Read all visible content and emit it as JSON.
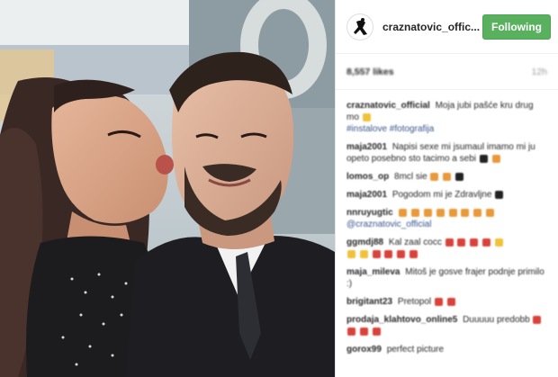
{
  "post": {
    "username": "craznatovic_offic...",
    "follow_label": "Following",
    "likes": "8,557 likes",
    "time": "12h"
  },
  "comments": [
    {
      "user": "craznatovic_official",
      "text": "Moja jubi pašće kru drug mo",
      "extra": "#instalove #fotografija"
    },
    {
      "user": "maja2001",
      "text": "Napisi sexe mi jsumaul imamo mi ju opeto posebno sto tacimo a sebi"
    },
    {
      "user": "lomos_op",
      "text": "8mcl sie"
    },
    {
      "user": "maja2001",
      "text": "Pogodom mi je Zdravljne"
    },
    {
      "user": "nnruyugtic",
      "text": "",
      "extra": "@craznatovic_official"
    },
    {
      "user": "ggmdj88",
      "text": "Kal zaal cocc"
    },
    {
      "user": "maja_mileva",
      "text": "Mitoš je gosve frajer podnje primilo :)"
    },
    {
      "user": "brigitant23",
      "text": "Pretopol"
    },
    {
      "user": "prodaja_klahtovo_online5",
      "text": "Duuuuu predobb"
    },
    {
      "user": "gorox99",
      "text": "perfect picture"
    }
  ],
  "colors": {
    "following_bg": "#59b15f",
    "emoji_red": "#d9423a",
    "emoji_orange": "#e89a3a",
    "emoji_yellow": "#f0c23a"
  }
}
